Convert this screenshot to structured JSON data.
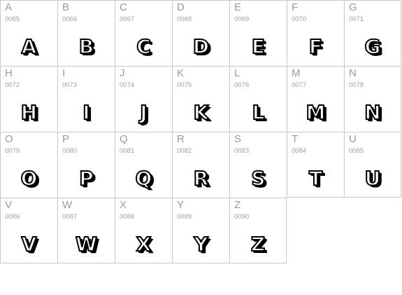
{
  "glyphs": [
    {
      "char": "A",
      "code": "0065"
    },
    {
      "char": "B",
      "code": "0066"
    },
    {
      "char": "C",
      "code": "0067"
    },
    {
      "char": "D",
      "code": "0068"
    },
    {
      "char": "E",
      "code": "0069"
    },
    {
      "char": "F",
      "code": "0070"
    },
    {
      "char": "G",
      "code": "0071"
    },
    {
      "char": "H",
      "code": "0072"
    },
    {
      "char": "I",
      "code": "0073"
    },
    {
      "char": "J",
      "code": "0074"
    },
    {
      "char": "K",
      "code": "0075"
    },
    {
      "char": "L",
      "code": "0076"
    },
    {
      "char": "M",
      "code": "0077"
    },
    {
      "char": "N",
      "code": "0078"
    },
    {
      "char": "O",
      "code": "0079"
    },
    {
      "char": "P",
      "code": "0080"
    },
    {
      "char": "Q",
      "code": "0081"
    },
    {
      "char": "R",
      "code": "0082"
    },
    {
      "char": "S",
      "code": "0083"
    },
    {
      "char": "T",
      "code": "0084"
    },
    {
      "char": "U",
      "code": "0085"
    },
    {
      "char": "V",
      "code": "0086"
    },
    {
      "char": "W",
      "code": "0087"
    },
    {
      "char": "X",
      "code": "0088"
    },
    {
      "char": "Y",
      "code": "0089"
    },
    {
      "char": "Z",
      "code": "0090"
    }
  ]
}
